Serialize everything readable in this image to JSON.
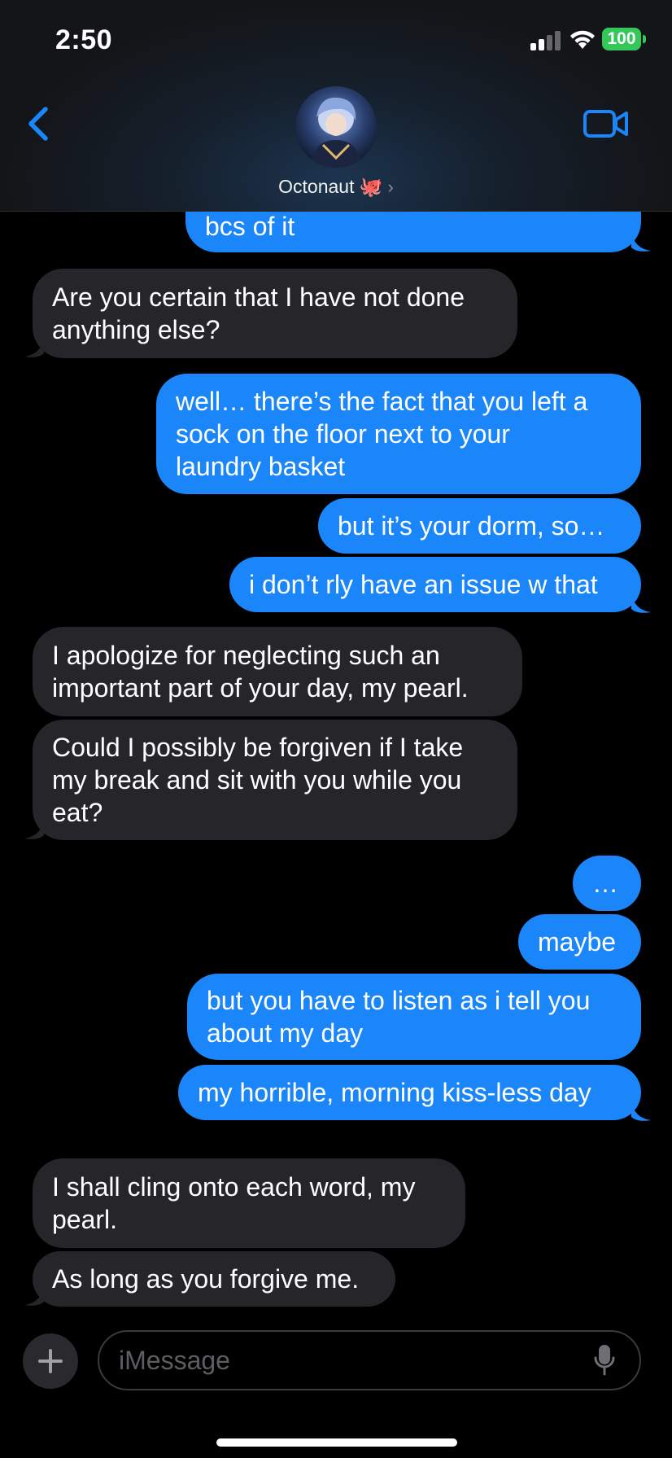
{
  "status_bar": {
    "time": "2:50",
    "battery": "100"
  },
  "header": {
    "contact_name": "Octonaut 🐙",
    "chevron": "›"
  },
  "icons": {
    "back": "chevron-left-icon",
    "video": "video-camera-icon",
    "signal": "cellular-signal-icon",
    "wifi": "wifi-icon",
    "plus": "plus-icon",
    "mic": "microphone-icon"
  },
  "colors": {
    "sent_bubble": "#1b86f9",
    "received_bubble": "#26262a",
    "accent": "#1b86f9",
    "battery": "#34c759"
  },
  "messages": [
    {
      "from": "me",
      "lines": [
        "bcs of it"
      ]
    },
    {
      "from": "them",
      "lines": [
        "Are you certain that I have not done",
        "anything else?"
      ]
    },
    {
      "from": "me",
      "lines": [
        "well… there’s the fact that you left a",
        "sock on the floor next to your",
        "laundry basket"
      ]
    },
    {
      "from": "me",
      "lines": [
        "but it’s your dorm, so…"
      ]
    },
    {
      "from": "me",
      "lines": [
        "i don’t rly have an issue w that"
      ]
    },
    {
      "from": "them",
      "lines": [
        "I apologize for neglecting such an",
        "important part of your day, my pearl."
      ]
    },
    {
      "from": "them",
      "lines": [
        "Could I possibly be forgiven if I take",
        "my break and sit with you while you",
        "eat?"
      ]
    },
    {
      "from": "me",
      "lines": [
        "…"
      ]
    },
    {
      "from": "me",
      "lines": [
        "maybe"
      ]
    },
    {
      "from": "me",
      "lines": [
        "but you have to listen as i tell you",
        "about my day"
      ]
    },
    {
      "from": "me",
      "lines": [
        "my horrible, morning kiss-less day"
      ]
    },
    {
      "from": "them",
      "lines": [
        "I shall cling onto each word, my",
        "pearl."
      ]
    },
    {
      "from": "them",
      "lines": [
        "As long as you forgive me."
      ]
    }
  ],
  "input": {
    "placeholder": "iMessage",
    "value": ""
  }
}
